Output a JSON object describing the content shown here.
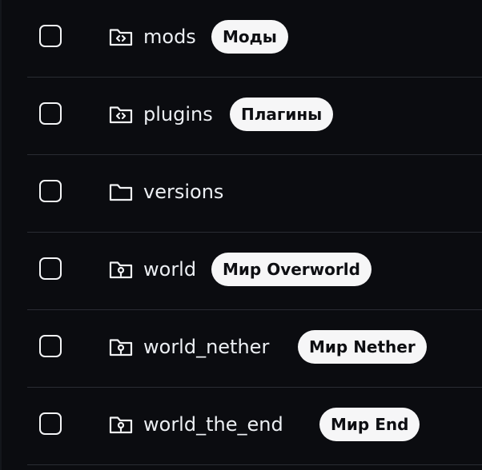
{
  "rows": [
    {
      "name": "mods",
      "icon": "folder-code-icon",
      "badge": "Моды"
    },
    {
      "name": "plugins",
      "icon": "folder-code-icon",
      "badge": "Плагины"
    },
    {
      "name": "versions",
      "icon": "folder-icon",
      "badge": ""
    },
    {
      "name": "world",
      "icon": "folder-pin-icon",
      "badge": "Мир Overworld"
    },
    {
      "name": "world_nether",
      "icon": "folder-pin-icon",
      "badge": "Мир Nether"
    },
    {
      "name": "world_the_end",
      "icon": "folder-pin-icon",
      "badge": "Мир End"
    }
  ],
  "colors": {
    "background": "#0b0c10",
    "text": "#eceff3",
    "badge_bg": "#f6f6f7",
    "badge_text": "#0d0e12",
    "divider": "#2a2c33"
  }
}
